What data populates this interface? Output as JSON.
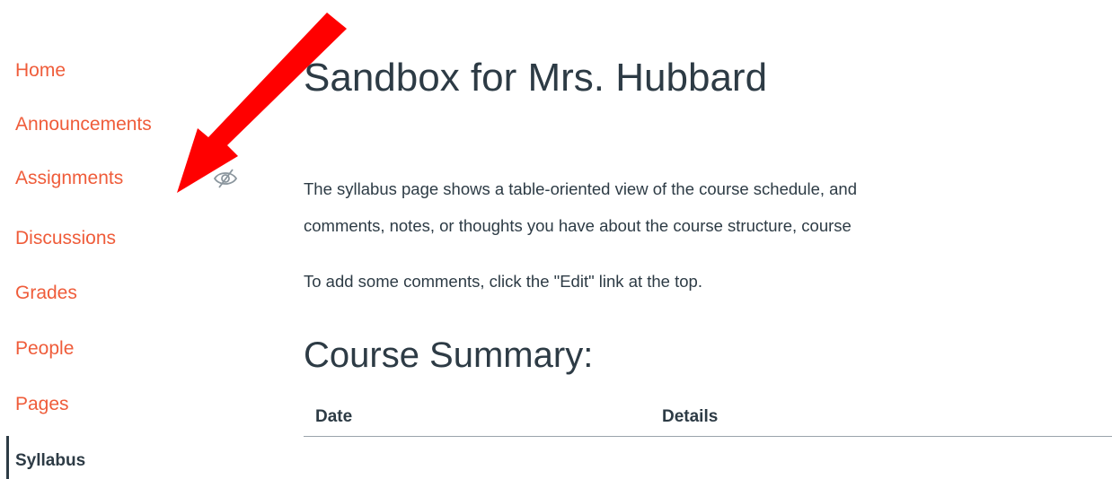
{
  "nav": {
    "items": [
      {
        "label": "Home"
      },
      {
        "label": "Announcements"
      },
      {
        "label": "Assignments"
      },
      {
        "label": "Discussions"
      },
      {
        "label": "Grades"
      },
      {
        "label": "People"
      },
      {
        "label": "Pages"
      },
      {
        "label": "Syllabus"
      }
    ],
    "active_item": "Syllabus",
    "hidden_item": "Assignments"
  },
  "main": {
    "title": "Sandbox for Mrs. Hubbard",
    "description_line1": "The syllabus page shows a table-oriented view of the course schedule, and",
    "description_line2": "comments, notes, or thoughts you have about the course structure, course",
    "description_line3": "To add some comments, click the \"Edit\" link at the top.",
    "summary_heading": "Course Summary:",
    "table_headers": [
      "Date",
      "Details"
    ]
  },
  "icons": {
    "hidden_from_students": "eye-slash-icon",
    "annotation_arrow": "red-arrow-icon"
  },
  "colors": {
    "nav_link": "#ef5c3a",
    "text": "#2d3b45",
    "arrow": "#ff0000"
  }
}
